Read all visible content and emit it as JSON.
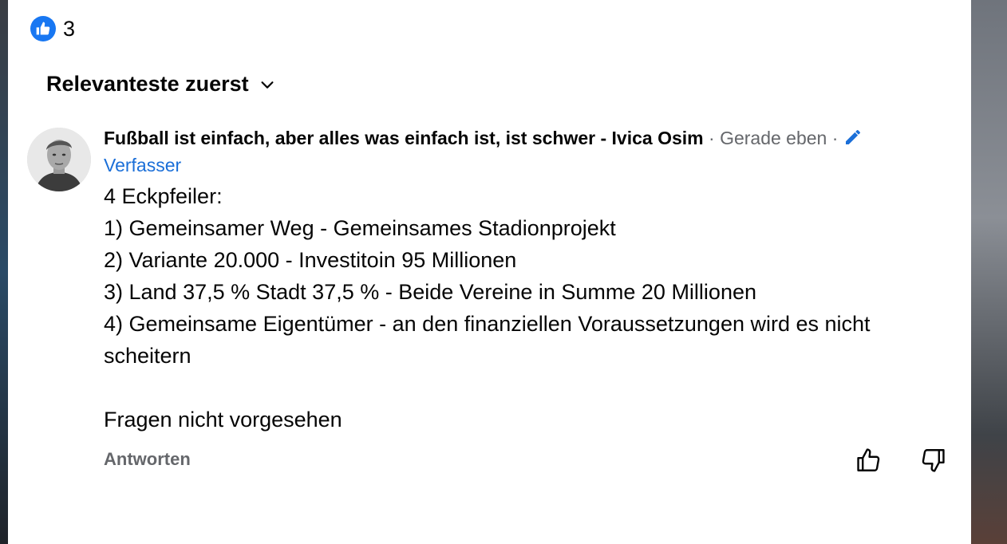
{
  "reactions": {
    "count": "3",
    "icon": "thumbs-up-icon"
  },
  "sort": {
    "label": "Relevanteste zuerst"
  },
  "comment": {
    "author": "Fußball ist einfach, aber alles was einfach ist, ist schwer - Ivica Osim",
    "separator": " · ",
    "time": "Gerade eben",
    "separator2": " · ",
    "badge": "Verfasser",
    "lines": [
      "4 Eckpfeiler:",
      "1) Gemeinsamer Weg - Gemeinsames Stadionprojekt",
      "2) Variante 20.000 - Investitoin 95 Millionen",
      "3) Land 37,5 % Stadt 37,5 % - Beide Vereine in Summe 20 Millionen",
      "4) Gemeinsame Eigentümer - an den finanziellen Voraussetzungen wird es nicht scheitern",
      "",
      "Fragen nicht vorgesehen"
    ],
    "reply_label": "Antworten"
  },
  "colors": {
    "accent": "#1877f2",
    "link": "#1b6fd8",
    "muted": "#65676b"
  }
}
